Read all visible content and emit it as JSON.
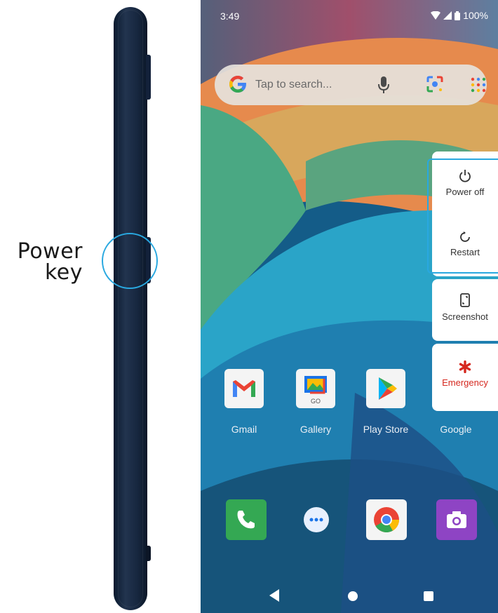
{
  "annotation": {
    "line1": "Power",
    "line2": "key"
  },
  "status_bar": {
    "time": "3:49",
    "battery": "100%"
  },
  "search_bar": {
    "logo": "G",
    "placeholder": "Tap to search..."
  },
  "power_menu": {
    "power_off": "Power off",
    "restart": "Restart",
    "screenshot": "Screenshot",
    "emergency": "Emergency",
    "emergency_color": "#d5281f"
  },
  "apps": [
    {
      "label": "Gmail"
    },
    {
      "label": "Gallery"
    },
    {
      "label": "Play Store"
    },
    {
      "label": "Google"
    }
  ],
  "dock": [
    {
      "icon": "phone-icon"
    },
    {
      "icon": "messages-icon"
    },
    {
      "icon": "chrome-icon"
    },
    {
      "icon": "camera-icon"
    }
  ],
  "gallery_badge": "GO",
  "accent_color": "#29a8e0"
}
